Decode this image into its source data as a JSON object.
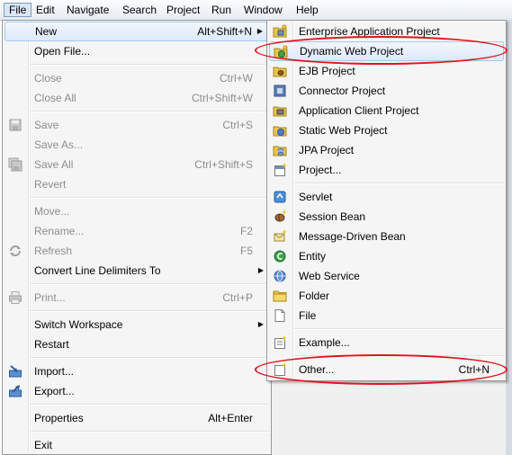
{
  "menubar": {
    "items": [
      {
        "label": "File"
      },
      {
        "label": "Edit"
      },
      {
        "label": "Navigate"
      },
      {
        "label": "Search"
      },
      {
        "label": "Project"
      },
      {
        "label": "Run"
      },
      {
        "label": "Window"
      },
      {
        "label": "Help"
      }
    ]
  },
  "file_menu": {
    "items": [
      {
        "label": "New",
        "accel": "Alt+Shift+N"
      },
      {
        "label": "Open File..."
      },
      {
        "label": "Close",
        "accel": "Ctrl+W"
      },
      {
        "label": "Close All",
        "accel": "Ctrl+Shift+W"
      },
      {
        "label": "Save",
        "accel": "Ctrl+S"
      },
      {
        "label": "Save As..."
      },
      {
        "label": "Save All",
        "accel": "Ctrl+Shift+S"
      },
      {
        "label": "Revert"
      },
      {
        "label": "Move..."
      },
      {
        "label": "Rename...",
        "accel": "F2"
      },
      {
        "label": "Refresh",
        "accel": "F5"
      },
      {
        "label": "Convert Line Delimiters To"
      },
      {
        "label": "Print...",
        "accel": "Ctrl+P"
      },
      {
        "label": "Switch Workspace"
      },
      {
        "label": "Restart"
      },
      {
        "label": "Import..."
      },
      {
        "label": "Export..."
      },
      {
        "label": "Properties",
        "accel": "Alt+Enter"
      },
      {
        "label": "Exit"
      }
    ]
  },
  "new_submenu": {
    "items": [
      {
        "label": "Enterprise Application Project"
      },
      {
        "label": "Dynamic Web Project"
      },
      {
        "label": "EJB Project"
      },
      {
        "label": "Connector Project"
      },
      {
        "label": "Application Client Project"
      },
      {
        "label": "Static Web Project"
      },
      {
        "label": "JPA Project"
      },
      {
        "label": "Project..."
      },
      {
        "label": "Servlet"
      },
      {
        "label": "Session Bean"
      },
      {
        "label": "Message-Driven Bean"
      },
      {
        "label": "Entity"
      },
      {
        "label": "Web Service"
      },
      {
        "label": "Folder"
      },
      {
        "label": "File"
      },
      {
        "label": "Example..."
      },
      {
        "label": "Other...",
        "accel": "Ctrl+N"
      }
    ]
  },
  "colors": {
    "highlight_ellipse": "#e0141b",
    "menu_bg": "#f5f5f5",
    "disabled_text": "#8d8d8d"
  }
}
